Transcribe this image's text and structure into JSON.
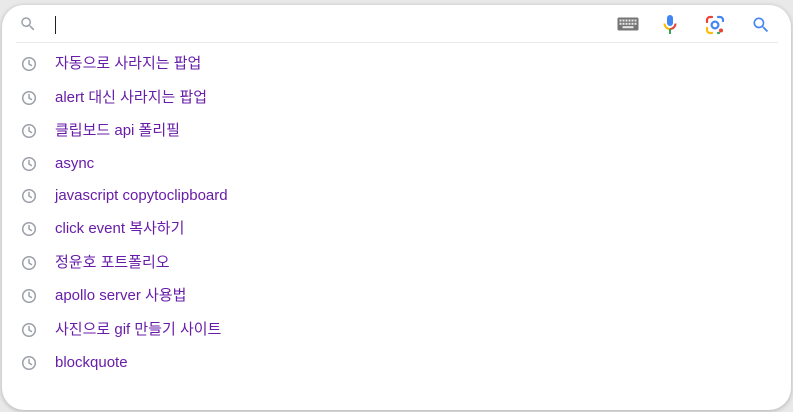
{
  "search": {
    "query": ""
  },
  "icons": {
    "search": "search-icon",
    "keyboard": "keyboard-icon",
    "voice": "microphone-icon",
    "lens": "lens-icon",
    "submit": "search-icon",
    "history": "history-clock-icon"
  },
  "colors": {
    "suggestion_text": "#681da8",
    "icon_gray": "#9aa0a6",
    "google_blue": "#4285f4",
    "google_red": "#ea4335",
    "google_yellow": "#fbbc04",
    "google_green": "#34a853"
  },
  "suggestions": [
    {
      "label": "자동으로 사라지는 팝업"
    },
    {
      "label": "alert 대신 사라지는 팝업"
    },
    {
      "label": "클립보드 api 폴리필"
    },
    {
      "label": "async"
    },
    {
      "label": "javascript copytoclipboard"
    },
    {
      "label": "click event 복사하기"
    },
    {
      "label": "정윤호 포트폴리오"
    },
    {
      "label": "apollo server 사용법"
    },
    {
      "label": "사진으로 gif 만들기 사이트"
    },
    {
      "label": "blockquote"
    }
  ]
}
